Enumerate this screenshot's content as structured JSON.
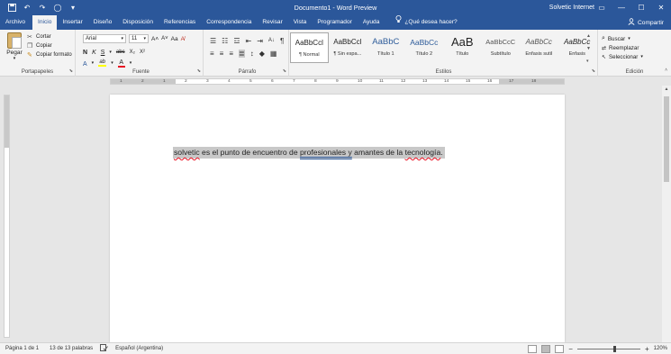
{
  "window": {
    "title": "Documento1 - Word Preview",
    "user": "Solvetic Internet",
    "qat_icons": [
      "save-icon",
      "undo-icon",
      "redo-icon",
      "touch-mode-icon",
      "customize-icon"
    ]
  },
  "tabs": [
    "Archivo",
    "Inicio",
    "Insertar",
    "Diseño",
    "Disposición",
    "Referencias",
    "Correspondencia",
    "Revisar",
    "Vista",
    "Programador",
    "Ayuda"
  ],
  "active_tab": "Inicio",
  "tell_me": "¿Qué desea hacer?",
  "share_label": "Compartir",
  "ribbon": {
    "clipboard": {
      "paste": "Pegar",
      "cut": "Cortar",
      "copy": "Copiar",
      "format_painter": "Copiar formato",
      "label": "Portapapeles"
    },
    "font": {
      "name": "Arial",
      "size": "11",
      "label": "Fuente",
      "bold": "N",
      "italic": "K",
      "underline": "S",
      "strike": "abc",
      "subscript": "X₂",
      "superscript": "X²",
      "grow": "A˄",
      "shrink": "A˅",
      "case": "Aa",
      "clear": "A̸",
      "effects": "A",
      "highlight": "ab",
      "font_color": "A"
    },
    "paragraph": {
      "label": "Párrafo"
    },
    "styles": {
      "label": "Estilos",
      "items": [
        {
          "preview": "AaBbCcl",
          "name": "¶ Normal"
        },
        {
          "preview": "AaBbCcl",
          "name": "¶ Sin espa..."
        },
        {
          "preview": "AaBbC",
          "name": "Título 1"
        },
        {
          "preview": "AaBbCc",
          "name": "Título 2"
        },
        {
          "preview": "AaB",
          "name": "Título"
        },
        {
          "preview": "AaBbCcC",
          "name": "Subtítulo"
        },
        {
          "preview": "AaBbCc",
          "name": "Énfasis sutil"
        },
        {
          "preview": "AaBbCc",
          "name": "Énfasis"
        }
      ]
    },
    "editing": {
      "label": "Edición",
      "find": "Buscar",
      "replace": "Reemplazar",
      "select": "Seleccionar"
    }
  },
  "document": {
    "words": [
      {
        "text": "solvetic",
        "mark": "spell"
      },
      {
        "text": " es el punto de encuentro de ",
        "mark": ""
      },
      {
        "text": "profesionales  y",
        "mark": "gram"
      },
      {
        "text": " amantes de la ",
        "mark": ""
      },
      {
        "text": "tecnología",
        "mark": "spell"
      },
      {
        "text": ".",
        "mark": ""
      }
    ]
  },
  "ruler_numbers": [
    "1",
    "2",
    "1",
    "2",
    "3",
    "4",
    "5",
    "6",
    "7",
    "8",
    "9",
    "10",
    "11",
    "12",
    "13",
    "14",
    "15",
    "16",
    "17",
    "18"
  ],
  "status": {
    "page": "Página 1 de 1",
    "words": "13 de 13 palabras",
    "language": "Español (Argentina)",
    "zoom": "120%",
    "zoom_fraction": 0.6
  },
  "colors": {
    "accent": "#2b579a",
    "selection": "#c8c8c8",
    "font_color_bar": "#e81123",
    "highlight_bar": "#ffff00"
  }
}
